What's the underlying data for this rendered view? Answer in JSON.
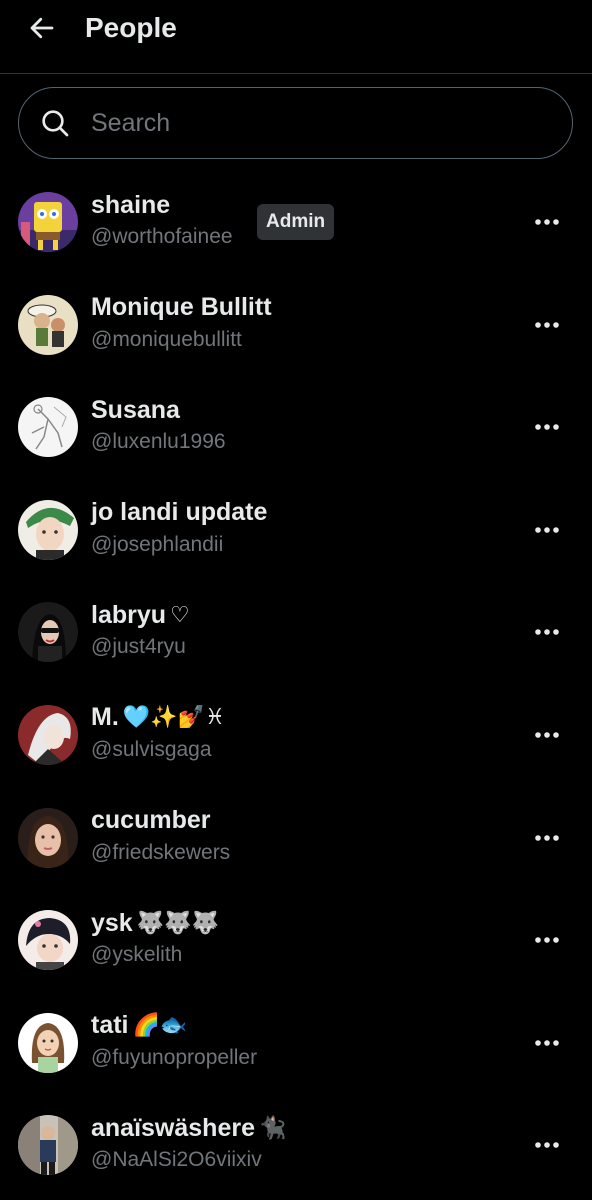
{
  "header": {
    "title": "People",
    "back_icon": "arrow-left-icon"
  },
  "search": {
    "placeholder": "Search",
    "value": ""
  },
  "colors": {
    "background": "#000000",
    "text_primary": "#e7e9ea",
    "text_secondary": "#71767b",
    "border": "#2f3336",
    "badge_bg": "#2f3336"
  },
  "people": [
    {
      "name": "shaine",
      "emoji": "",
      "handle": "@worthofainee",
      "badge": "Admin"
    },
    {
      "name": "Monique Bullitt",
      "emoji": "",
      "handle": "@moniquebullitt",
      "badge": ""
    },
    {
      "name": "Susana",
      "emoji": "",
      "handle": "@luxenlu1996",
      "badge": ""
    },
    {
      "name": "jo landi update",
      "emoji": "",
      "handle": "@josephlandii",
      "badge": ""
    },
    {
      "name": "labryu",
      "emoji": "♡",
      "handle": "@just4ryu",
      "badge": ""
    },
    {
      "name": "M.",
      "emoji": "🩵✨💅♓",
      "handle": "@sulvisgaga",
      "badge": ""
    },
    {
      "name": "cucumber",
      "emoji": "",
      "handle": "@friedskewers",
      "badge": ""
    },
    {
      "name": "ysk",
      "emoji": "🐺🐺🐺",
      "handle": "@yskelith",
      "badge": ""
    },
    {
      "name": "tati",
      "emoji": "🌈🐟",
      "handle": "@fuyunopropeller",
      "badge": ""
    },
    {
      "name": "anaïswäshere",
      "emoji": "🐈‍⬛",
      "handle": "@NaAlSi2O6viixiv",
      "badge": ""
    }
  ]
}
